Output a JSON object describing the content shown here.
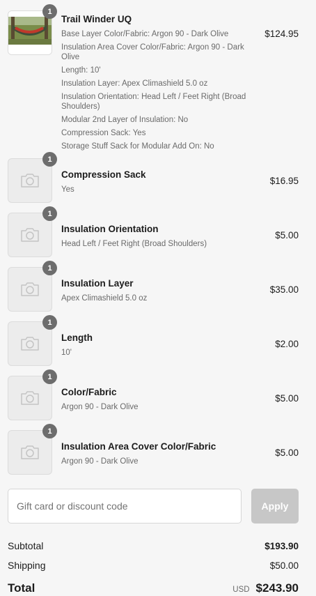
{
  "items": [
    {
      "name": "Trail Winder UQ",
      "quantity": "1",
      "price": "$124.95",
      "image": "hammock-photo",
      "options": [
        "Base Layer Color/Fabric: Argon 90 - Dark Olive",
        "Insulation Area Cover Color/Fabric: Argon 90 - Dark Olive",
        "Length: 10'",
        "Insulation Layer: Apex Climashield 5.0 oz",
        "Insulation Orientation: Head Left / Feet Right (Broad Shoulders)",
        "Modular 2nd Layer of Insulation: No",
        "Compression Sack: Yes",
        "Storage Stuff Sack for Modular Add On: No"
      ]
    },
    {
      "name": "Compression Sack",
      "quantity": "1",
      "price": "$16.95",
      "option": "Yes",
      "image": "camera-placeholder-icon"
    },
    {
      "name": "Insulation Orientation",
      "quantity": "1",
      "price": "$5.00",
      "option": "Head Left / Feet Right (Broad Shoulders)",
      "image": "camera-placeholder-icon"
    },
    {
      "name": "Insulation Layer",
      "quantity": "1",
      "price": "$35.00",
      "option": "Apex Climashield 5.0 oz",
      "image": "camera-placeholder-icon"
    },
    {
      "name": "Length",
      "quantity": "1",
      "price": "$2.00",
      "option": "10'",
      "image": "camera-placeholder-icon"
    },
    {
      "name": "Color/Fabric",
      "quantity": "1",
      "price": "$5.00",
      "option": "Argon 90 - Dark Olive",
      "image": "camera-placeholder-icon"
    },
    {
      "name": "Insulation Area Cover Color/Fabric",
      "quantity": "1",
      "price": "$5.00",
      "option": "Argon 90 - Dark Olive",
      "image": "camera-placeholder-icon"
    }
  ],
  "discount": {
    "placeholder": "Gift card or discount code",
    "apply_label": "Apply"
  },
  "totals": {
    "subtotal_label": "Subtotal",
    "subtotal": "$193.90",
    "shipping_label": "Shipping",
    "shipping": "$50.00",
    "total_label": "Total",
    "currency": "USD",
    "total": "$243.90"
  },
  "colors": {
    "background": "#f6f6f6",
    "badge": "#6d6d6d",
    "apply_disabled": "#c7c7c7",
    "muted_text": "#6a6a6a"
  }
}
